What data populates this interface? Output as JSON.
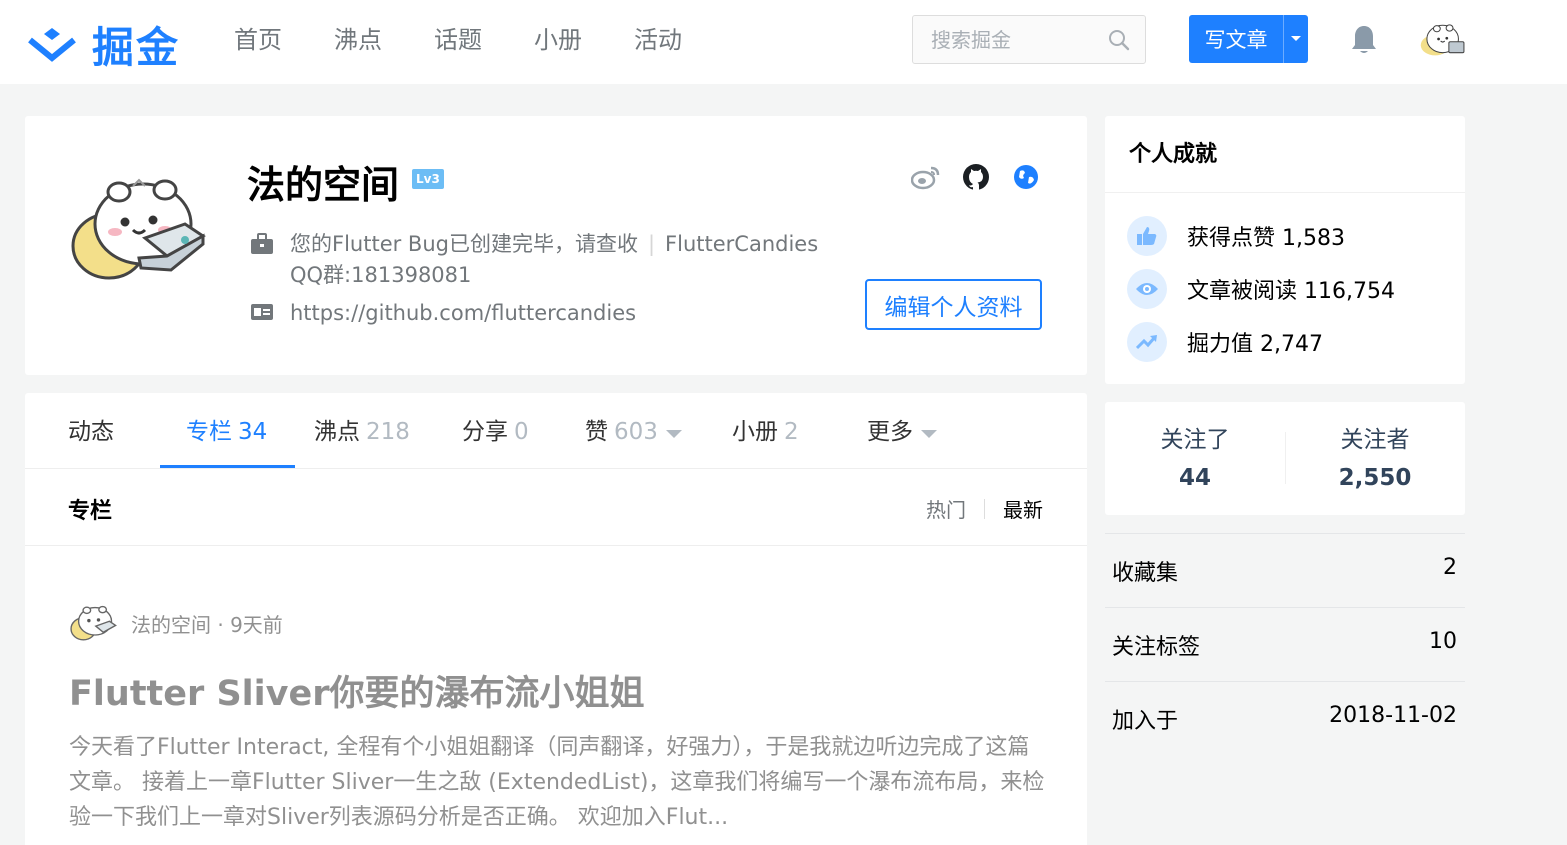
{
  "header": {
    "logo_text": "掘金",
    "nav": [
      "首页",
      "沸点",
      "话题",
      "小册",
      "活动"
    ],
    "search_placeholder": "搜索掘金",
    "write_label": "写文章"
  },
  "profile": {
    "username": "法的空间",
    "level": "Lv3",
    "bio": "您的Flutter Bug已创建完毕，请查收",
    "company": "FlutterCandies",
    "bio_line2": "QQ群:181398081",
    "website": "https://github.com/fluttercandies",
    "edit_label": "编辑个人资料"
  },
  "tabs": [
    {
      "label": "动态",
      "count": ""
    },
    {
      "label": "专栏",
      "count": "34"
    },
    {
      "label": "沸点",
      "count": "218"
    },
    {
      "label": "分享",
      "count": "0"
    },
    {
      "label": "赞",
      "count": "603"
    },
    {
      "label": "小册",
      "count": "2"
    },
    {
      "label": "更多",
      "count": ""
    }
  ],
  "section": {
    "title": "专栏",
    "sort_hot": "热门",
    "sort_new": "最新"
  },
  "article": {
    "meta": "法的空间 · 9天前",
    "title": "Flutter Sliver你要的瀑布流小姐姐",
    "abstract": "今天看了Flutter Interact, 全程有个小姐姐翻译（同声翻译，好强力），于是我就边听边完成了这篇文章。 接着上一章Flutter Sliver一生之敌 (ExtendedList)，这章我们将编写一个瀑布流布局，来检验一下我们上一章对Sliver列表源码分析是否正确。 欢迎加入Flut..."
  },
  "achievements": {
    "title": "个人成就",
    "items": [
      {
        "label": "获得点赞 1,583"
      },
      {
        "label": "文章被阅读 116,754"
      },
      {
        "label": "掘力值 2,747"
      }
    ]
  },
  "follow": {
    "following_label": "关注了",
    "following": "44",
    "followers_label": "关注者",
    "followers": "2,550"
  },
  "stats": [
    {
      "label": "收藏集",
      "value": "2"
    },
    {
      "label": "关注标签",
      "value": "10"
    },
    {
      "label": "加入于",
      "value": "2018-11-02"
    }
  ],
  "colors": {
    "brand": "#1e80ff",
    "muted": "#909090",
    "icon_bg": "#e1efff"
  }
}
